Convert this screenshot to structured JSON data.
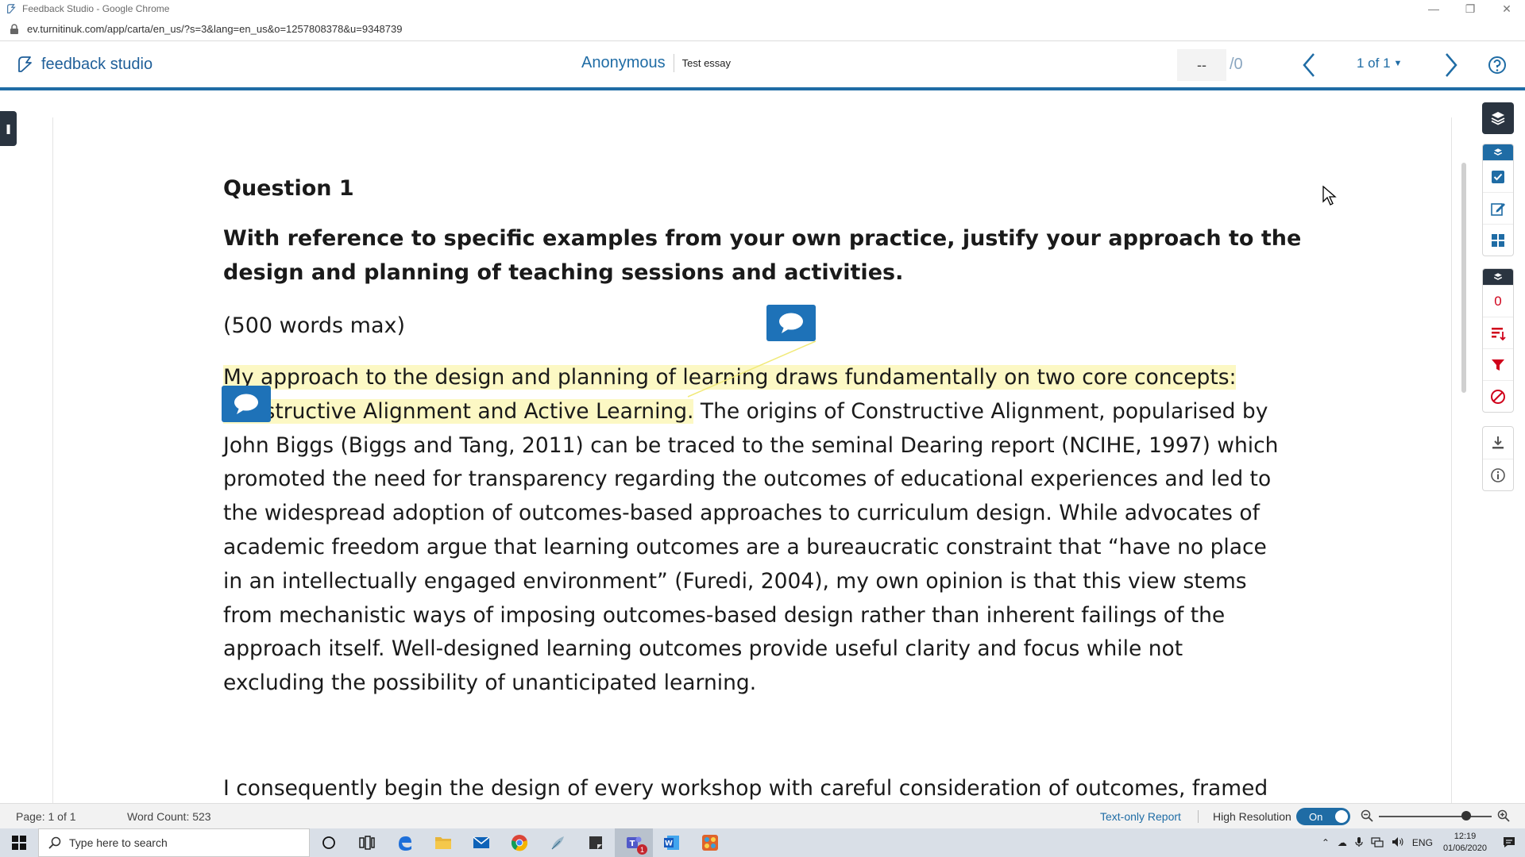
{
  "window": {
    "title": "Feedback Studio - Google Chrome"
  },
  "address": {
    "url": "ev.turnitinuk.com/app/carta/en_us/?s=3&lang=en_us&o=1257808378&u=9348739"
  },
  "header": {
    "brand": "feedback studio",
    "author": "Anonymous",
    "assignment": "Test essay",
    "score": "--",
    "score_total": "/0",
    "page_label": "1 of 1"
  },
  "document": {
    "question_title": "Question 1",
    "question_prompt": "With reference to specific examples from your own practice, justify your approach to the design and planning of teaching sessions and activities.",
    "word_limit": "(500 words max)",
    "para1_highlight": "My approach to the design and planning of learning draws fundamentally on two core concepts: Constructive Alignment and Active Learning.",
    "para1_rest": " The origins of Constructive Alignment, popularised by John Biggs (Biggs and Tang, 2011) can be traced to the seminal Dearing report (NCIHE, 1997) which promoted the need for transparency regarding the outcomes of educational experiences and led to the widespread adoption of outcomes-based approaches to curriculum design. While advocates of academic freedom argue that learning outcomes are a bureaucratic constraint that “have no place in an intellectually engaged environment” (Furedi, 2004), my own opinion is that this view stems from mechanistic ways of imposing outcomes-based design rather than inherent failings of the approach itself. Well-designed learning outcomes provide useful clarity and focus while not excluding the possibility of unanticipated learning.",
    "para2_partial": "I consequently begin the design of every workshop with careful consideration of outcomes, framed"
  },
  "toolbar": {
    "flag_count": "0"
  },
  "statusbar": {
    "page": "Page: 1 of 1",
    "word_count": "Word Count: 523",
    "text_only": "Text-only Report",
    "high_res": "High Resolution",
    "toggle": "On"
  },
  "taskbar": {
    "search_placeholder": "Type here to search",
    "lang": "ENG",
    "time": "12:19",
    "date": "01/06/2020",
    "teams_badge": "1"
  },
  "colors": {
    "accent": "#1f6ca5",
    "highlight": "#fcf8c4",
    "comment": "#1e72b8",
    "danger": "#d0021b"
  }
}
